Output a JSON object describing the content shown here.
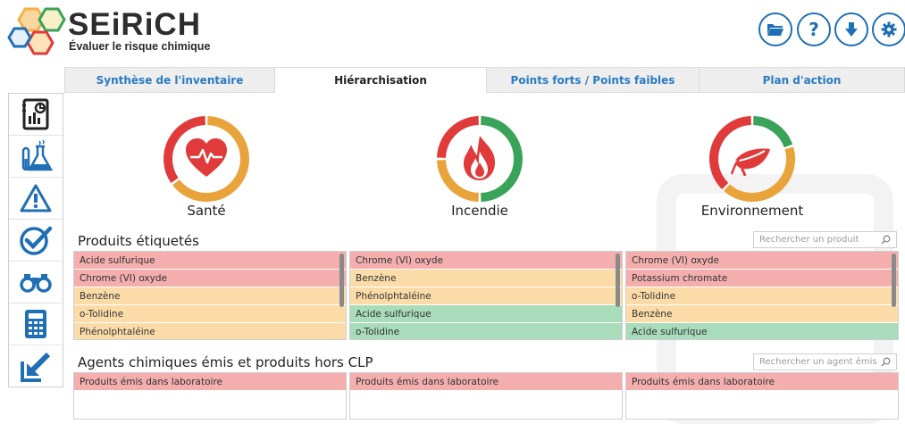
{
  "app": {
    "name": "SEiRiCH",
    "subtitle": "Évaluer le risque chimique"
  },
  "header_buttons": [
    {
      "name": "open-folder-button",
      "icon": "folder-icon"
    },
    {
      "name": "help-button",
      "icon": "question-icon",
      "glyph": "?"
    },
    {
      "name": "download-button",
      "icon": "download-icon"
    },
    {
      "name": "settings-button",
      "icon": "gear-icon"
    }
  ],
  "tabs": [
    {
      "label": "Synthèse de l'inventaire",
      "active": false
    },
    {
      "label": "Hiérarchisation",
      "active": true
    },
    {
      "label": "Points forts / Points faibles",
      "active": false
    },
    {
      "label": "Plan d'action",
      "active": false
    }
  ],
  "sidebar": [
    {
      "icon": "report-icon"
    },
    {
      "icon": "lab-flask-icon"
    },
    {
      "icon": "warning-icon"
    },
    {
      "icon": "check-icon"
    },
    {
      "icon": "binoculars-icon"
    },
    {
      "icon": "calculator-icon"
    },
    {
      "icon": "export-arrow-icon"
    }
  ],
  "gauges": [
    {
      "label": "Santé",
      "icon": "heart-icon",
      "red": 0.35,
      "orange": 0.65,
      "green": 0.0
    },
    {
      "label": "Incendie",
      "icon": "fire-icon",
      "red": 0.25,
      "orange": 0.25,
      "green": 0.5
    },
    {
      "label": "Environnement",
      "icon": "leaf-icon",
      "red": 0.38,
      "orange": 0.42,
      "green": 0.2
    }
  ],
  "colors": {
    "red": "#e03a3a",
    "orange": "#e8a33a",
    "green": "#3aa35a",
    "accent": "#1f6fb5"
  },
  "produits": {
    "title": "Produits étiquetés",
    "search_placeholder": "Rechercher un produit",
    "columns": [
      [
        {
          "text": "Acide sulfurique",
          "level": "red"
        },
        {
          "text": "Chrome (VI) oxyde",
          "level": "red"
        },
        {
          "text": "Benzène",
          "level": "orange"
        },
        {
          "text": "o-Tolidine",
          "level": "orange"
        },
        {
          "text": "Phénolphtaléine",
          "level": "orange"
        }
      ],
      [
        {
          "text": "Chrome (VI) oxyde",
          "level": "red"
        },
        {
          "text": "Benzène",
          "level": "orange"
        },
        {
          "text": "Phénolphtaléine",
          "level": "orange"
        },
        {
          "text": "Acide sulfurique",
          "level": "green"
        },
        {
          "text": "o-Tolidine",
          "level": "green"
        }
      ],
      [
        {
          "text": "Chrome (VI) oxyde",
          "level": "red"
        },
        {
          "text": "Potassium chromate",
          "level": "red"
        },
        {
          "text": "o-Tolidine",
          "level": "orange"
        },
        {
          "text": "Benzène",
          "level": "orange"
        },
        {
          "text": "Acide sulfurique",
          "level": "green"
        }
      ]
    ]
  },
  "agents": {
    "title": "Agents chimiques émis et produits hors CLP",
    "search_placeholder": "Rechercher un agent émis",
    "columns": [
      [
        {
          "text": "Produits émis dans laboratoire",
          "level": "red"
        }
      ],
      [
        {
          "text": "Produits émis dans laboratoire",
          "level": "red"
        }
      ],
      [
        {
          "text": "Produits émis dans laboratoire",
          "level": "red"
        }
      ]
    ]
  }
}
